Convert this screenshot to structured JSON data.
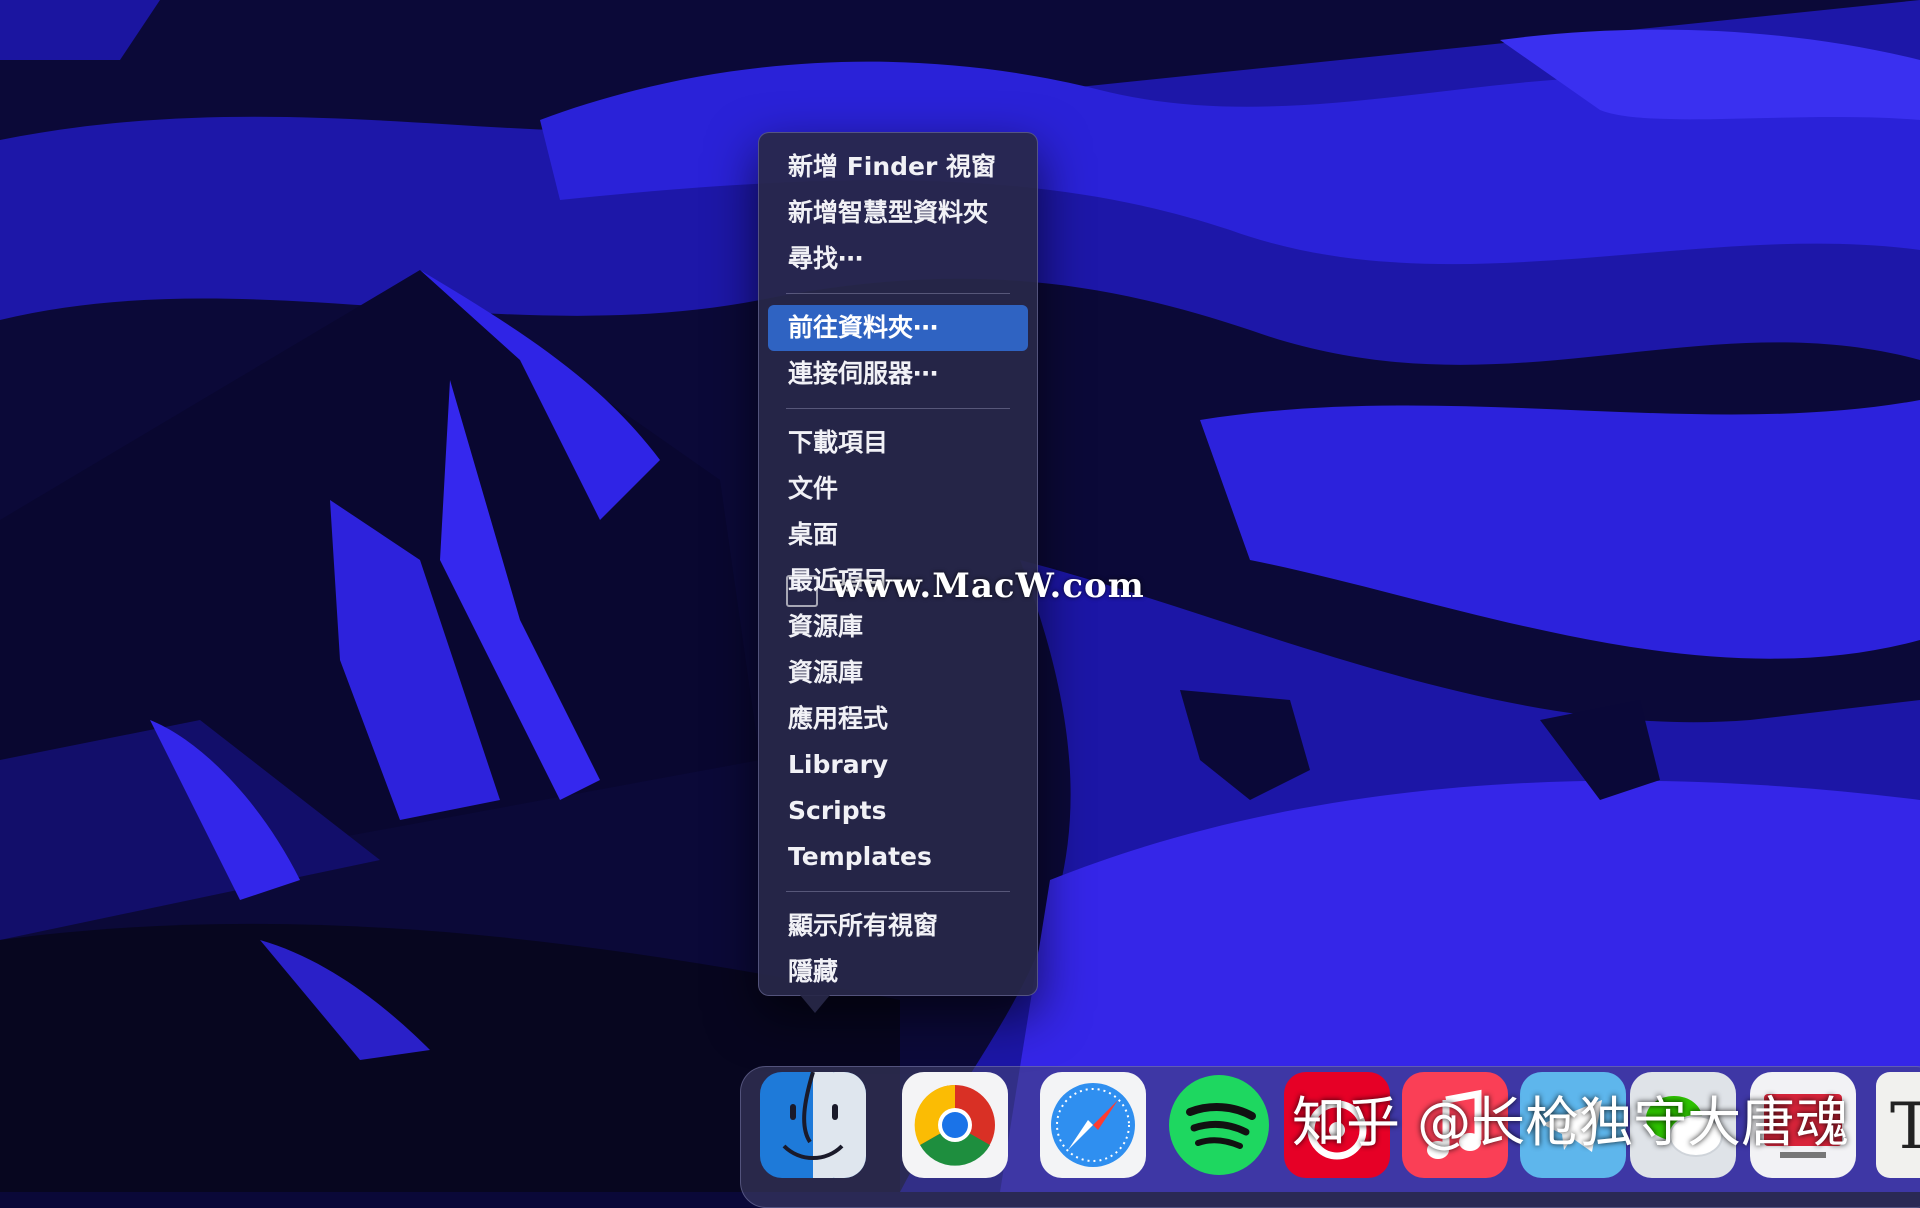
{
  "context_menu": {
    "items": [
      {
        "label": "新增 Finder 視窗",
        "selected": false
      },
      {
        "label": "新增智慧型資料夾",
        "selected": false
      },
      {
        "label": "尋找⋯",
        "selected": false
      },
      {
        "separator": true
      },
      {
        "label": "前往資料夾⋯",
        "selected": true
      },
      {
        "label": "連接伺服器⋯",
        "selected": false
      },
      {
        "separator": true
      },
      {
        "label": "下載項目",
        "selected": false
      },
      {
        "label": "文件",
        "selected": false
      },
      {
        "label": "桌面",
        "selected": false
      },
      {
        "label": "最近項目",
        "selected": false
      },
      {
        "label": "資源庫",
        "selected": false
      },
      {
        "label": "資源庫",
        "selected": false
      },
      {
        "label": "應用程式",
        "selected": false
      },
      {
        "label": "Library",
        "selected": false
      },
      {
        "label": "Scripts",
        "selected": false
      },
      {
        "label": "Templates",
        "selected": false
      },
      {
        "separator": true
      },
      {
        "label": "顯示所有視窗",
        "selected": false
      },
      {
        "label": "隱藏",
        "selected": false
      }
    ]
  },
  "watermark": "www.MacW.com",
  "credit": "知乎 @长枪独守大唐魂",
  "dock": {
    "icons": [
      "finder-icon",
      "chrome-icon",
      "safari-icon",
      "spotify-icon",
      "netease-music-icon",
      "apple-music-icon",
      "telegram-icon",
      "wechat-icon",
      "presentation-icon",
      "typora-icon"
    ]
  },
  "colors": {
    "selection": "#2f63c2",
    "wallpaper_dark": "#0a0838",
    "wallpaper_blue": "#2a1ce6"
  }
}
